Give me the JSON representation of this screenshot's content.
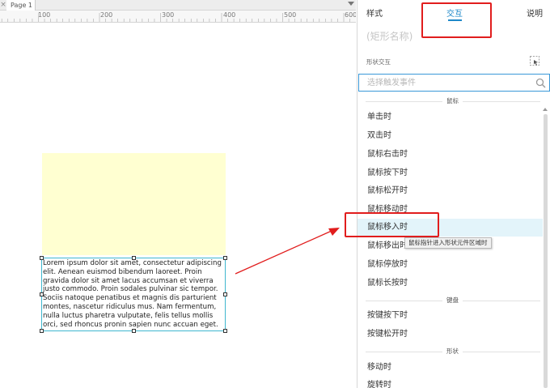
{
  "canvas": {
    "page_tab": "Page 1",
    "tab_close": "×",
    "ruler_labels": [
      "100",
      "200",
      "300",
      "400",
      "500",
      "600"
    ],
    "text_widget": "Lorem ipsum dolor sit amet, consectetur adipiscing elit. Aenean euismod bibendum laoreet. Proin gravida dolor sit amet lacus accumsan et viverra justo commodo. Proin sodales pulvinar sic tempor. Sociis natoque penatibus et magnis dis parturient montes, nascetur ridiculus mus. Nam fermentum, nulla luctus pharetra vulputate, felis tellus mollis orci, sed rhoncus pronin sapien nunc accuan eget.",
    "shape_fill": "#ffffd1",
    "selection_color": "#3fb7cf"
  },
  "panel": {
    "tabs": [
      {
        "label": "样式"
      },
      {
        "label": "交互",
        "active": true
      },
      {
        "label": "说明"
      }
    ],
    "shape_name_placeholder": "(矩形名称)",
    "section_label": "形状交互",
    "search_placeholder": "选择触发事件",
    "groups": [
      {
        "label": "鼠标",
        "items": [
          "单击时",
          "双击时",
          "鼠标右击时",
          "鼠标按下时",
          "鼠标松开时",
          "鼠标移动时",
          "鼠标移入时",
          "鼠标移出时",
          "鼠标停放时",
          "鼠标长按时"
        ]
      },
      {
        "label": "键盘",
        "items": [
          "按键按下时",
          "按键松开时"
        ]
      },
      {
        "label": "形状",
        "items": [
          "移动时",
          "旋转时"
        ]
      }
    ],
    "hovered_item": "鼠标移入时",
    "tooltip": "鼠标指针进入形状元件区域时",
    "accent_color": "#1e88c9",
    "annotation_color": "#e11d1d"
  }
}
